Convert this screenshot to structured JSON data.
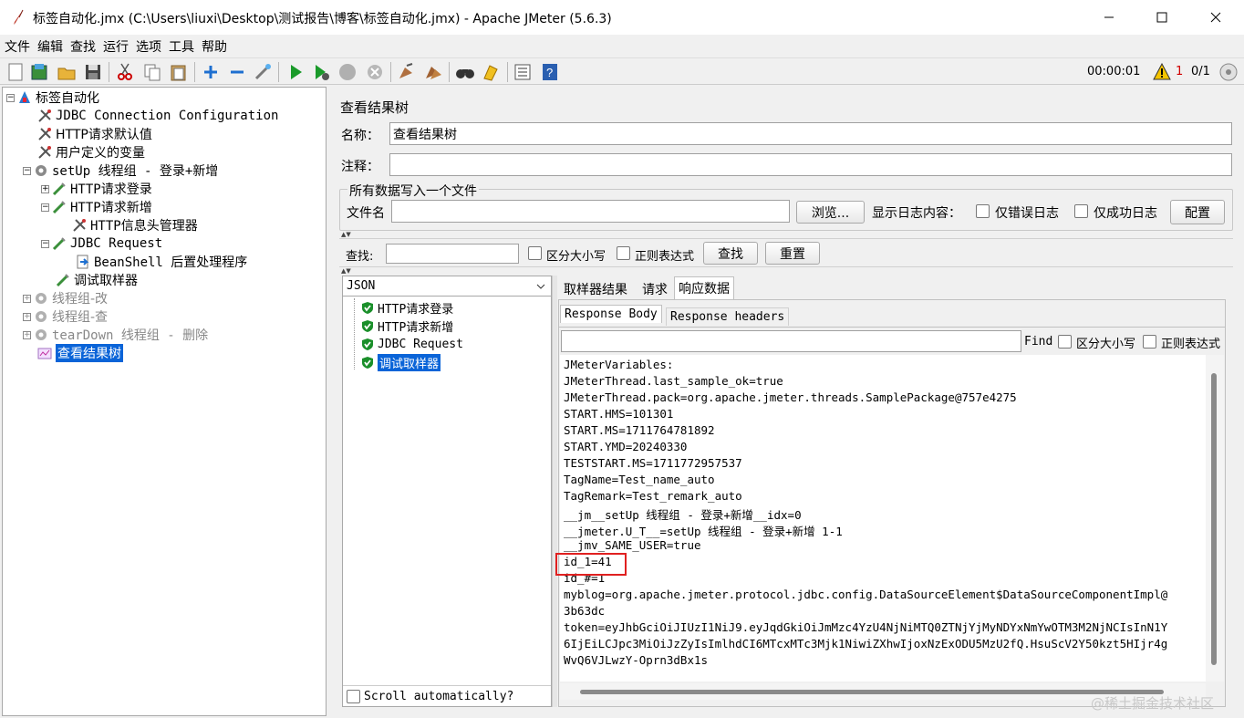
{
  "window": {
    "title": "标签自动化.jmx (C:\\Users\\liuxi\\Desktop\\测试报告\\博客\\标签自动化.jmx) - Apache JMeter (5.6.3)",
    "min_label": "—",
    "max_label": "☐",
    "close_label": "✕"
  },
  "menu": [
    "文件",
    "编辑",
    "查找",
    "运行",
    "选项",
    "工具",
    "帮助"
  ],
  "toolbar": {
    "icons": [
      "new-icon",
      "templates-icon",
      "open-icon",
      "save-icon",
      "cut-icon",
      "copy-icon",
      "paste-icon",
      "expand-icon",
      "collapse-icon",
      "toggle-icon",
      "start-icon",
      "start-no-pause-icon",
      "stop-icon",
      "shutdown-icon",
      "clear-icon",
      "clear-all-icon",
      "search-icon",
      "reset-search-icon",
      "function-helper-icon",
      "help-icon"
    ],
    "timer": "00:00:01",
    "warning_count": "1",
    "threads": "0/1"
  },
  "tree": {
    "items": [
      {
        "label": "标签自动化",
        "icon": "testplan-icon"
      },
      {
        "label": "JDBC Connection Configuration",
        "icon": "config-icon"
      },
      {
        "label": "HTTP请求默认值",
        "icon": "config-icon"
      },
      {
        "label": "用户定义的变量",
        "icon": "config-icon"
      },
      {
        "label": "setUp 线程组 - 登录+新增",
        "icon": "thread-group-icon"
      },
      {
        "label": "HTTP请求登录",
        "icon": "sampler-icon"
      },
      {
        "label": "HTTP请求新增",
        "icon": "sampler-icon"
      },
      {
        "label": "HTTP信息头管理器",
        "icon": "config-icon"
      },
      {
        "label": "JDBC Request",
        "icon": "sampler-icon"
      },
      {
        "label": "BeanShell 后置处理程序",
        "icon": "postprocessor-icon"
      },
      {
        "label": "调试取样器",
        "icon": "sampler-icon"
      },
      {
        "label": "线程组-改",
        "icon": "thread-group-icon"
      },
      {
        "label": "线程组-查",
        "icon": "thread-group-icon"
      },
      {
        "label": "tearDown 线程组 - 删除",
        "icon": "thread-group-icon"
      },
      {
        "label": "查看结果树",
        "icon": "listener-icon"
      }
    ]
  },
  "panel": {
    "heading": "查看结果树",
    "name_label": "名称：",
    "name_value": "查看结果树",
    "comment_label": "注释：",
    "comment_value": "",
    "file_group_title": "所有数据写入一个文件",
    "filename_label": "文件名",
    "filename_value": "",
    "browse_label": "浏览...",
    "log_label": "显示日志内容：",
    "errors_only_label": "仅错误日志",
    "success_only_label": "仅成功日志",
    "config_label": "配置",
    "search_label": "查找:",
    "search_value": "",
    "case_label": "区分大小写",
    "regex_label": "正则表达式",
    "find_button": "查找",
    "reset_button": "重置"
  },
  "results": {
    "renderer": "JSON",
    "items": [
      "HTTP请求登录",
      "HTTP请求新增",
      "JDBC Request",
      "调试取样器"
    ],
    "scroll_label": "Scroll automatically?"
  },
  "detail": {
    "tabs": [
      "取样器结果",
      "请求",
      "响应数据"
    ],
    "subtabs": [
      "Response Body",
      "Response headers"
    ],
    "find_label": "Find",
    "case_label": "区分大小写",
    "regex_label": "正则表达式",
    "lines": [
      "JMeterVariables:",
      "JMeterThread.last_sample_ok=true",
      "JMeterThread.pack=org.apache.jmeter.threads.SamplePackage@757e4275",
      "START.HMS=101301",
      "START.MS=1711764781892",
      "START.YMD=20240330",
      "TESTSTART.MS=1711772957537",
      "TagName=Test_name_auto",
      "TagRemark=Test_remark_auto",
      "__jm__setUp 线程组 - 登录+新增__idx=0",
      "__jmeter.U_T__=setUp 线程组 - 登录+新增 1-1",
      "__jmv_SAME_USER=true",
      "id_1=41",
      "id_#=1",
      "myblog=org.apache.jmeter.protocol.jdbc.config.DataSourceElement$DataSourceComponentImpl@",
      "3b63dc",
      "token=eyJhbGciOiJIUzI1NiJ9.eyJqdGkiOiJmMzc4YzU4NjNiMTQ0ZTNjYjMyNDYxNmYwOTM3M2NjNCIsInN1Y",
      "6IjEiLCJpc3MiOiJzZyIsImlhdCI6MTcxMTc3Mjk1NiwiZXhwIjoxNzExODU5MzU2fQ.HsuScV2Y50kzt5HIjr4g",
      "WvQ6VJLwzY-Oprn3dBx1s"
    ]
  },
  "watermark": "@稀土掘金技术社区"
}
